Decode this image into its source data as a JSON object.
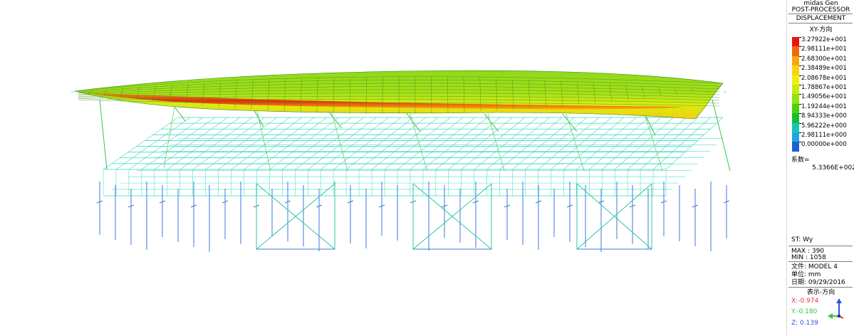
{
  "panel": {
    "app_name": "midas Gen",
    "mode": "POST-PROCESSOR",
    "result_type": "DISPLACEMENT",
    "component": "XY-方向",
    "legend": {
      "values": [
        "3.27922e+001",
        "2.98111e+001",
        "2.68300e+001",
        "2.38489e+001",
        "2.08678e+001",
        "1.78867e+001",
        "1.49056e+001",
        "1.19244e+001",
        "8.94333e+000",
        "5.96222e+000",
        "2.98111e+000",
        "0.00000e+000"
      ],
      "colors": [
        "#e8150b",
        "#f06a0a",
        "#f7a80b",
        "#fbd30d",
        "#f1f00c",
        "#c7ec0e",
        "#92e310",
        "#4ecf12",
        "#1abb34",
        "#15c7b4",
        "#1ea8e0",
        "#1a5fd6"
      ]
    },
    "factor_label": "系数=",
    "factor_value": "5.3366E+002",
    "st_label": "ST: Wy",
    "max_label": "MAX : 390",
    "min_label": "MIN : 1058",
    "file_label": "文件: MODEL 4",
    "unit_label": "单位: mm",
    "date_label": "日期: 09/29/2016",
    "view_label": "表示-方向",
    "axis_x": "X:-0.974",
    "axis_y": "Y:-0.180",
    "axis_z": "Z: 0.139",
    "axis_colors": {
      "x": "#e5383b",
      "y": "#35c24a",
      "z": "#2b55d8"
    }
  }
}
